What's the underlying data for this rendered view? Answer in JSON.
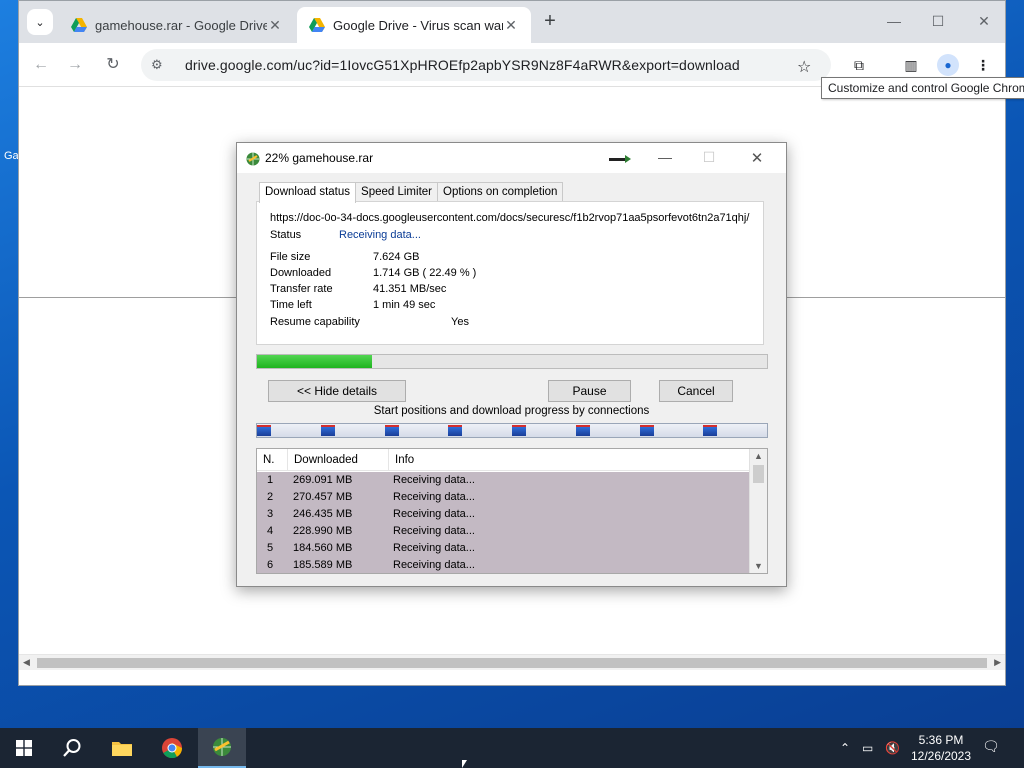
{
  "browser": {
    "tabs": [
      {
        "title": "gamehouse.rar - Google Drive",
        "active": false
      },
      {
        "title": "Google Drive - Virus scan warni",
        "active": true
      }
    ],
    "url": "drive.google.com/uc?id=1IovcG51XpHROEfp2apbYSR9Nz8F4aRWR&export=download",
    "tooltip": "Customize and control Google Chrome"
  },
  "idm": {
    "title": "22% gamehouse.rar",
    "tabs": [
      "Download status",
      "Speed Limiter",
      "Options on completion"
    ],
    "source_url": "https://doc-0o-34-docs.googleusercontent.com/docs/securesc/f1b2rvop71aa5psorfevot6tn2a71qhj/",
    "fields": {
      "status_label": "Status",
      "status_value": "Receiving data...",
      "filesize_label": "File size",
      "filesize_value": "7.624  GB",
      "downloaded_label": "Downloaded",
      "downloaded_value": "1.714  GB  ( 22.49 % )",
      "rate_label": "Transfer rate",
      "rate_value": "41.351  MB/sec",
      "timeleft_label": "Time left",
      "timeleft_value": "1 min 49 sec",
      "resume_label": "Resume capability",
      "resume_value": "Yes"
    },
    "progress_fraction": 0.2249,
    "buttons": {
      "hide_details": "<< Hide details",
      "pause": "Pause",
      "cancel": "Cancel"
    },
    "connections_title": "Start positions and download progress by connections",
    "connection_starts": [
      0.0,
      0.125,
      0.25,
      0.375,
      0.5,
      0.625,
      0.75,
      0.875
    ],
    "table": {
      "headers": [
        "N.",
        "Downloaded",
        "Info"
      ],
      "rows": [
        [
          "1",
          "269.091  MB",
          "Receiving data..."
        ],
        [
          "2",
          "270.457  MB",
          "Receiving data..."
        ],
        [
          "3",
          "246.435  MB",
          "Receiving data..."
        ],
        [
          "4",
          "228.990  MB",
          "Receiving data..."
        ],
        [
          "5",
          "184.560  MB",
          "Receiving data..."
        ],
        [
          "6",
          "185.589  MB",
          "Receiving data..."
        ]
      ]
    }
  },
  "taskbar": {
    "time": "5:36 PM",
    "date": "12/26/2023"
  },
  "desktop": {
    "icon_stub": "Ga"
  },
  "colors": {
    "progress": "#22b422",
    "drive_green": "#0f9d58",
    "drive_yellow": "#f4b400",
    "drive_blue": "#4285f4"
  }
}
